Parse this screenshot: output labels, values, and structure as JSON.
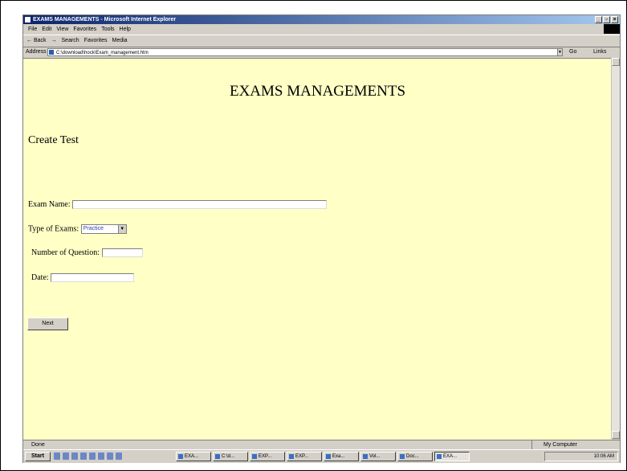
{
  "window": {
    "title": "EXAMS MANAGEMENTS - Microsoft Internet Explorer",
    "min": "_",
    "max": "▫",
    "close": "×"
  },
  "menu": [
    "File",
    "Edit",
    "View",
    "Favorites",
    "Tools",
    "Help"
  ],
  "toolbar": {
    "back": "← Back",
    "forward": "→",
    "search": "Search",
    "favorites": "Favorites",
    "media": "Media"
  },
  "address": {
    "label": "Address",
    "url": "C:\\download\\hock\\Exam_management.htm",
    "go": "Go",
    "links": "Links"
  },
  "page": {
    "title": "EXAMS MANAGEMENTS",
    "section": "Create Test",
    "exam_name_label": "Exam Name:",
    "exam_name_value": "",
    "type_label": "Type of Exams:",
    "type_selected": "Practice",
    "num_questions_label": "Number of Question:",
    "num_questions_value": "",
    "date_label": "Date:",
    "date_value": "",
    "next_button": "Next"
  },
  "status": {
    "text": "Done",
    "zone": "My Computer"
  },
  "taskbar": {
    "start": "Start",
    "tasks": [
      "EXA...",
      "C:\\d...",
      "EXP...",
      "EXP...",
      "Exa...",
      "Vol...",
      "Doc...",
      "EXA..."
    ],
    "clock": "10:06 AM"
  }
}
